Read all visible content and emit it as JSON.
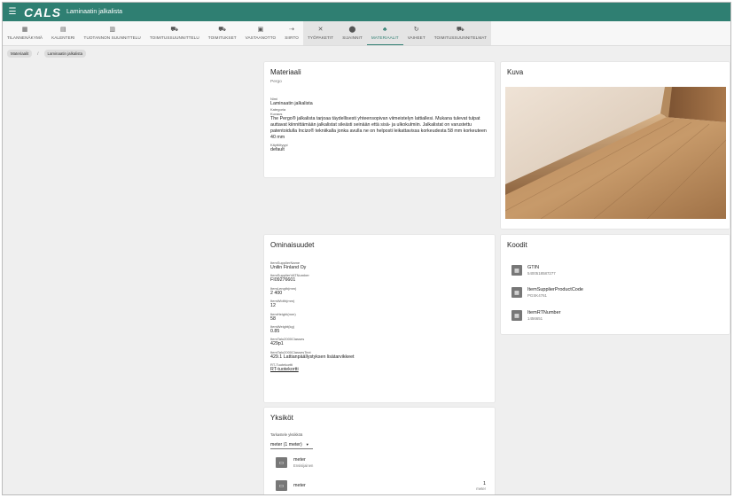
{
  "app": {
    "logo": "CALS",
    "title": "Laminaatin jalkalista"
  },
  "nav": [
    {
      "label": "Tilannenäkymä",
      "icon": "dashboard-icon",
      "glyph": "▦"
    },
    {
      "label": "Kalenteri",
      "icon": "calendar-icon",
      "glyph": "▤"
    },
    {
      "label": "Tuotannon suunnittelu",
      "icon": "grid-icon",
      "glyph": "▥"
    },
    {
      "label": "Toimitussuunnittelu",
      "icon": "truck-icon",
      "glyph": "⛟"
    },
    {
      "label": "Toimitukset",
      "icon": "truck-icon",
      "glyph": "⛟"
    },
    {
      "label": "Vastaanotto",
      "icon": "inbox-icon",
      "glyph": "▣"
    },
    {
      "label": "Siirto",
      "icon": "transfer-icon",
      "glyph": "⇢"
    },
    {
      "label": "Työpaketit",
      "icon": "tools-icon",
      "glyph": "✕"
    },
    {
      "label": "Sijainnit",
      "icon": "location-icon",
      "glyph": "⬤"
    },
    {
      "label": "Materiaalit",
      "icon": "materials-icon",
      "glyph": "♣"
    },
    {
      "label": "Vaiheet",
      "icon": "sync-icon",
      "glyph": "↻"
    },
    {
      "label": "Toimitussuunnitelmat",
      "icon": "truck-icon",
      "glyph": "⛟"
    }
  ],
  "breadcrumb": {
    "root": "Materiaalit",
    "sep": "/",
    "current": "Laminaatin jalkalista"
  },
  "material": {
    "title": "Materiaali",
    "subtitle": "Pergo",
    "name_label": "Nimi",
    "name": "Laminaatin jalkalista",
    "category_label": "Kategoria",
    "description_label": "Kuvaus",
    "description": "The Pergo® jalkalista tarjoaa täydellisesti yhteensopivan viimeistelyn lattiallesi. Mukana tulevat tulpat auttavat kiinnittämään jalkalistat sileästi seinään että sisä- ja ulkokulmiin. Jalkalistat on varustettu patentoidulla Incizo® tekniikalla jonka avulla ne on helposti leikattavissa korkeudesta 58 mm korkeuteen 40 mm",
    "usage_label": "Käyttötyypi",
    "usage": "default"
  },
  "image_card": {
    "title": "Kuva"
  },
  "properties": {
    "title": "Ominaisuudet",
    "items": [
      {
        "label": "ItemSupplierName",
        "value": "Unilin Finland Oy"
      },
      {
        "label": "ItemSupplierVATNumber",
        "value": "FI09276601"
      },
      {
        "label": "ItemLength(mm)",
        "value": "2 400"
      },
      {
        "label": "ItemWidth(mm)",
        "value": "12"
      },
      {
        "label": "ItemHeight(mm)",
        "value": "58"
      },
      {
        "label": "ItemWeight(kg)",
        "value": "0.85"
      },
      {
        "label": "ItemTalo2000Classes",
        "value": "429p1"
      },
      {
        "label": "ItemTalo2000ClassesText",
        "value": "429.1 Lattianpäällystyksen lisätarvikkeet"
      }
    ],
    "rt_label": "RT-Tuotekortti",
    "rt_link": "RT-tuotekortti"
  },
  "codes": {
    "title": "Koodit",
    "items": [
      {
        "name": "GTIN",
        "value": "5400518587277"
      },
      {
        "name": "ItemSupplierProductCode",
        "value": "PGSK4761"
      },
      {
        "name": "ItemRTNumber",
        "value": "1456651"
      }
    ]
  },
  "units": {
    "title": "Yksiköt",
    "select_label": "Tarkastele yksikköä",
    "selected": "meter (1 meter)",
    "rows": [
      {
        "name": "meter",
        "sub": "Ensisijainen"
      },
      {
        "name": "meter",
        "qty": "1",
        "qty_unit": "meter"
      }
    ]
  }
}
